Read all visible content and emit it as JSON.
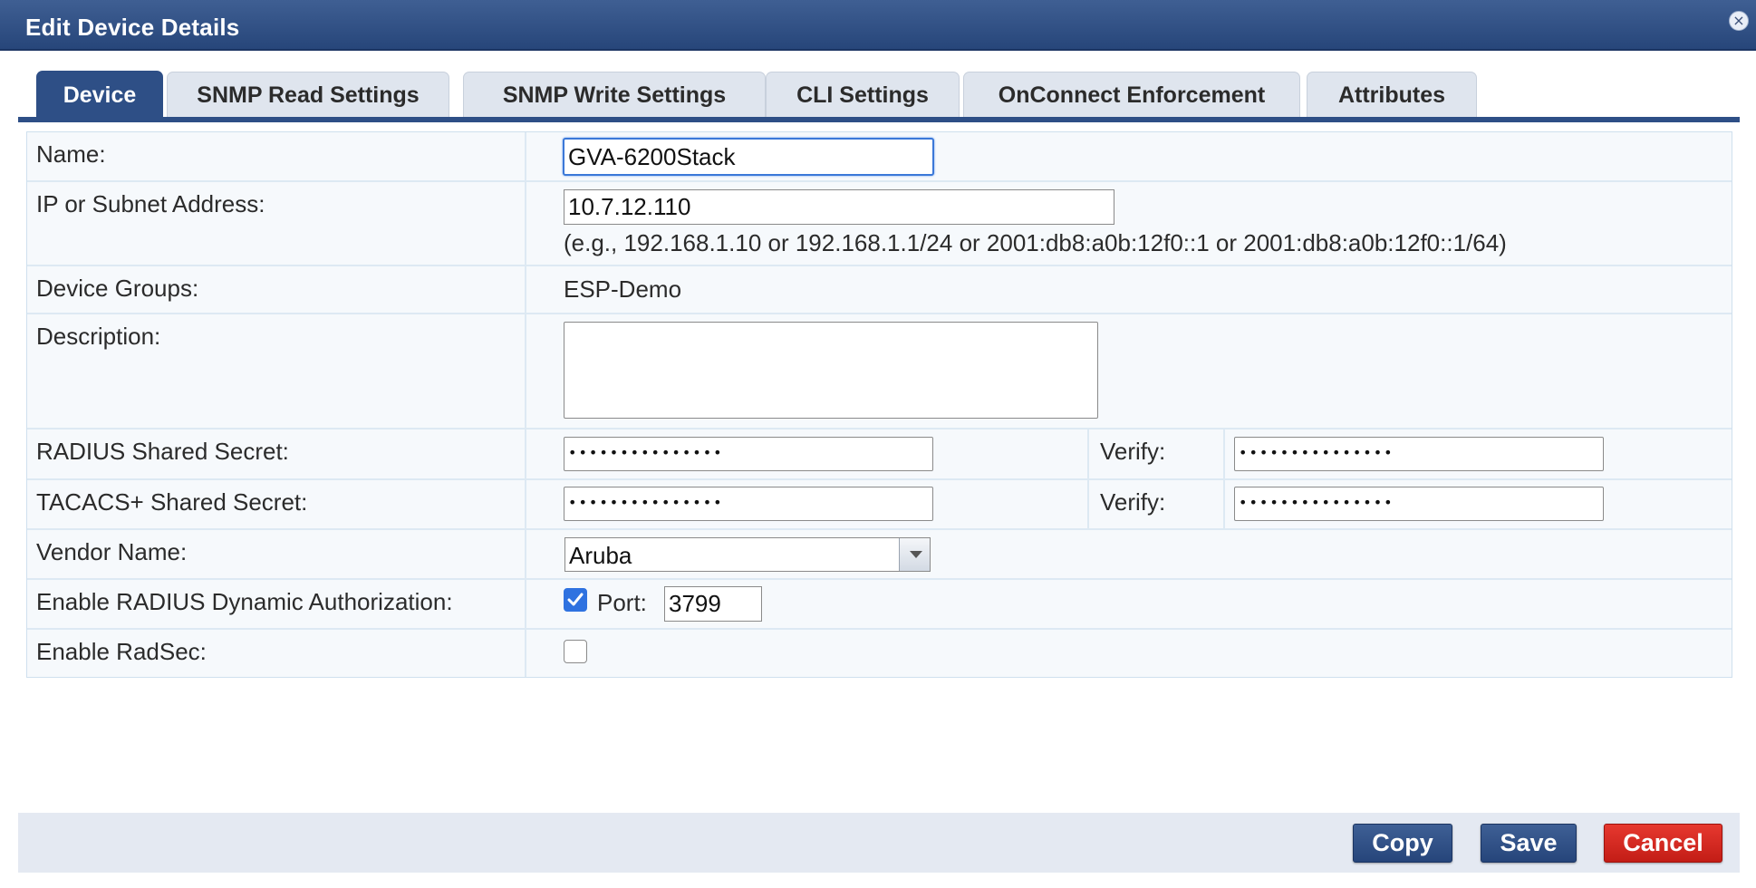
{
  "dialog": {
    "title": "Edit Device Details",
    "close_icon": "close-icon"
  },
  "tabs": [
    {
      "label": "Device",
      "active": true
    },
    {
      "label": "SNMP Read Settings",
      "active": false
    },
    {
      "label": "SNMP Write Settings",
      "active": false
    },
    {
      "label": "CLI Settings",
      "active": false
    },
    {
      "label": "OnConnect Enforcement",
      "active": false
    },
    {
      "label": "Attributes",
      "active": false
    }
  ],
  "form": {
    "name": {
      "label": "Name:",
      "value": "GVA-6200Stack"
    },
    "ip": {
      "label": "IP or Subnet Address:",
      "value": "10.7.12.110",
      "hint": "(e.g., 192.168.1.10 or 192.168.1.1/24 or 2001:db8:a0b:12f0::1 or 2001:db8:a0b:12f0::1/64)"
    },
    "device_groups": {
      "label": "Device Groups:",
      "value": "ESP-Demo"
    },
    "description": {
      "label": "Description:",
      "value": ""
    },
    "radius_secret": {
      "label": "RADIUS Shared Secret:",
      "masked_value": "•••••••••••••••",
      "verify_label": "Verify:",
      "verify_masked_value": "•••••••••••••••"
    },
    "tacacs_secret": {
      "label": "TACACS+ Shared Secret:",
      "masked_value": "•••••••••••••••",
      "verify_label": "Verify:",
      "verify_masked_value": "•••••••••••••••"
    },
    "vendor": {
      "label": "Vendor Name:",
      "value": "Aruba"
    },
    "radius_dynamic_auth": {
      "label": "Enable RADIUS Dynamic Authorization:",
      "checked": true,
      "port_label": "Port:",
      "port_value": "3799"
    },
    "radsec": {
      "label": "Enable RadSec:",
      "checked": false
    }
  },
  "footer": {
    "copy_label": "Copy",
    "save_label": "Save",
    "cancel_label": "Cancel"
  },
  "colors": {
    "title_bar": "#2e4f86",
    "active_tab": "#2e4f86",
    "checkbox_checked": "#2f72e0",
    "cancel_button": "#d2261e",
    "primary_button": "#2e4f86"
  }
}
